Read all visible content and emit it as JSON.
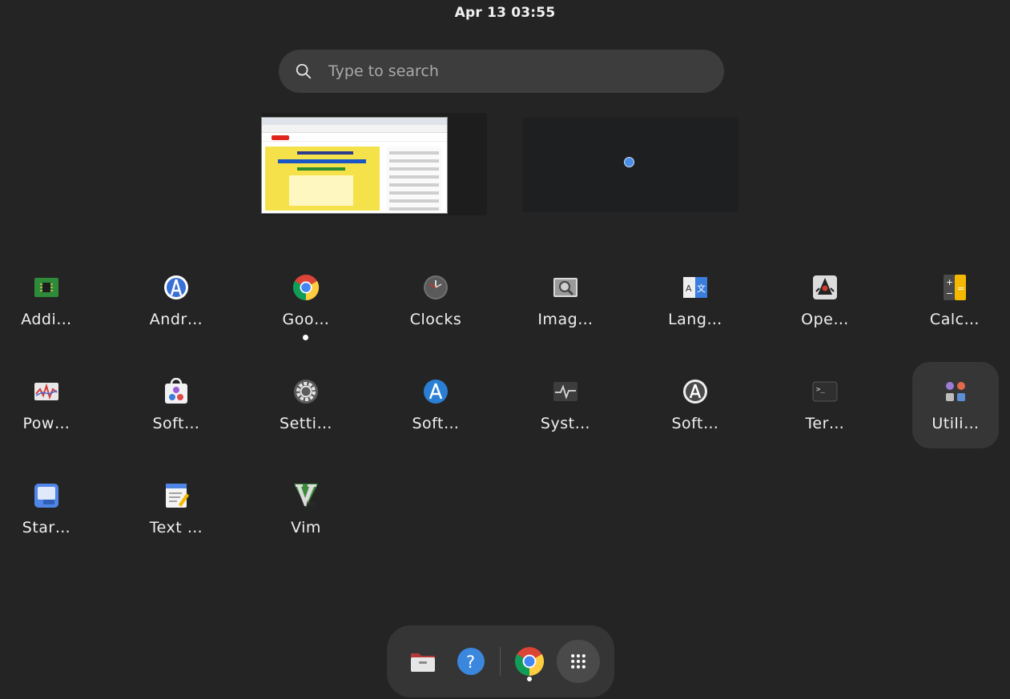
{
  "top_bar": {
    "clock": "Apr 13  03:55"
  },
  "search": {
    "placeholder": "Type to search"
  },
  "apps": [
    {
      "label": "Addi…",
      "icon": "addi-chip-icon"
    },
    {
      "label": "Andr…",
      "icon": "android-studio-icon"
    },
    {
      "label": "Goo…",
      "icon": "google-chrome-icon"
    },
    {
      "label": "Clocks",
      "icon": "clocks-icon"
    },
    {
      "label": "Imag…",
      "icon": "image-viewer-icon"
    },
    {
      "label": "Lang…",
      "icon": "language-icon"
    },
    {
      "label": "Ope…",
      "icon": "openjdk-duke-icon"
    },
    {
      "label": "Calc…",
      "icon": "calculator-icon"
    },
    {
      "label": "Pow…",
      "icon": "power-statistics-icon"
    },
    {
      "label": "Soft…",
      "icon": "software-bag-icon"
    },
    {
      "label": "Setti…",
      "icon": "settings-gear-icon"
    },
    {
      "label": "Soft…",
      "icon": "software-updater-icon"
    },
    {
      "label": "Syst…",
      "icon": "system-monitor-icon"
    },
    {
      "label": "Soft…",
      "icon": "software-properties-icon"
    },
    {
      "label": "Ter…",
      "icon": "terminal-icon"
    },
    {
      "label": "Utili…",
      "icon": "utilities-folder-icon"
    },
    {
      "label": "Star…",
      "icon": "startup-disk-icon"
    },
    {
      "label": "Text …",
      "icon": "text-editor-icon"
    },
    {
      "label": "Vim",
      "icon": "vim-icon"
    }
  ],
  "dock": {
    "items": [
      "files-icon",
      "help-icon",
      "google-chrome-icon",
      "show-apps-icon"
    ]
  },
  "colors": {
    "background": "#242424",
    "search_bg": "#3d3d3d",
    "dock_bg": "#353535",
    "hover_tile": "#363636"
  }
}
